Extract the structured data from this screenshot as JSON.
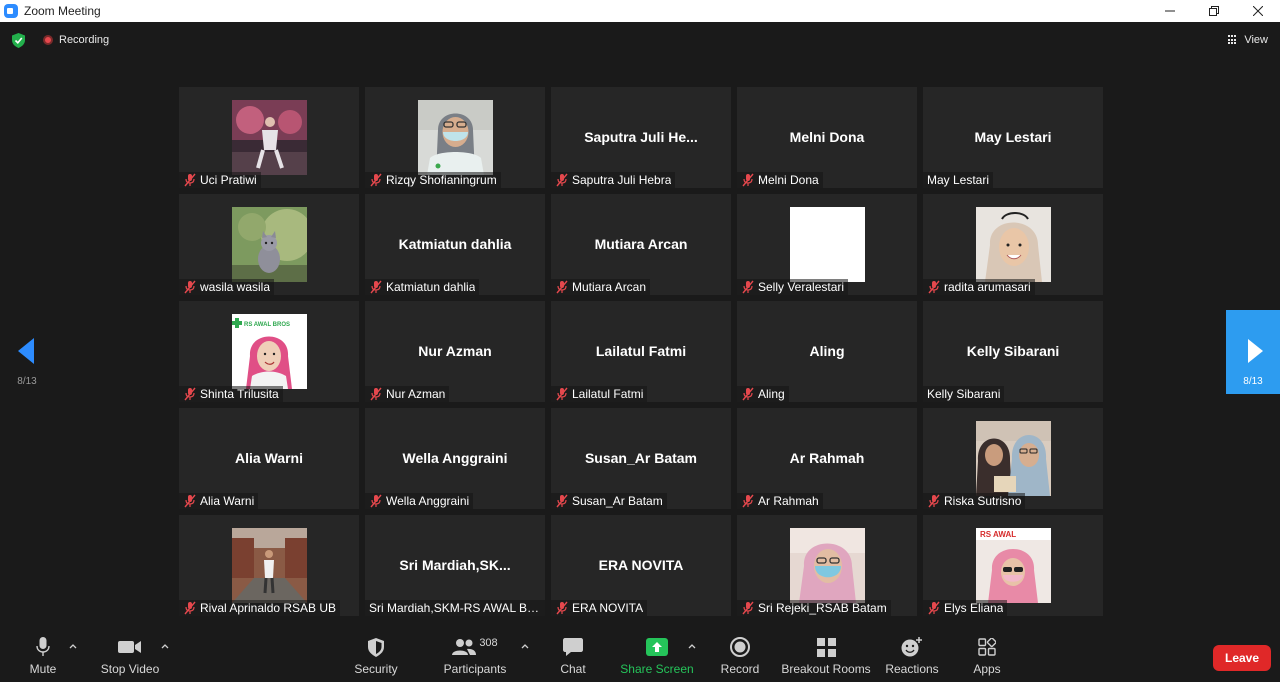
{
  "window": {
    "title": "Zoom Meeting"
  },
  "topbar": {
    "recording_label": "Recording",
    "view_label": "View"
  },
  "pagination": {
    "left_page": "8/13",
    "right_page": "8/13"
  },
  "participants": [
    {
      "name": "Uci Pratiwi",
      "display": "",
      "muted": true,
      "photo": "stage"
    },
    {
      "name": "Rizqy Shofianingrum",
      "display": "",
      "muted": true,
      "photo": "nurse-mask"
    },
    {
      "name": "Saputra Juli Hebra",
      "display": "Saputra  Juli  He...",
      "muted": true,
      "photo": ""
    },
    {
      "name": "Melni Dona",
      "display": "Melni Dona",
      "muted": true,
      "photo": ""
    },
    {
      "name": "May Lestari",
      "display": "May Lestari",
      "muted": false,
      "photo": ""
    },
    {
      "name": "wasila wasila",
      "display": "",
      "muted": true,
      "photo": "cat"
    },
    {
      "name": "Katmiatun dahlia",
      "display": "Katmiatun dahlia",
      "muted": true,
      "photo": ""
    },
    {
      "name": "Mutiara Arcan",
      "display": "Mutiara Arcan",
      "muted": true,
      "photo": ""
    },
    {
      "name": "Selly Veralestari",
      "display": "",
      "muted": true,
      "photo": "white"
    },
    {
      "name": "radita arumasari",
      "display": "",
      "muted": true,
      "photo": "hijab-smile"
    },
    {
      "name": "Shinta Trilusita",
      "display": "",
      "muted": true,
      "photo": "pink-hijab"
    },
    {
      "name": "Nur Azman",
      "display": "Nur Azman",
      "muted": true,
      "photo": ""
    },
    {
      "name": "Lailatul Fatmi",
      "display": "Lailatul Fatmi",
      "muted": true,
      "photo": ""
    },
    {
      "name": "Aling",
      "display": "Aling",
      "muted": true,
      "photo": ""
    },
    {
      "name": "Kelly Sibarani",
      "display": "Kelly Sibarani",
      "muted": false,
      "photo": ""
    },
    {
      "name": "Alia Warni",
      "display": "Alia Warni",
      "muted": true,
      "photo": ""
    },
    {
      "name": "Wella Anggraini",
      "display": "Wella Anggraini",
      "muted": true,
      "photo": ""
    },
    {
      "name": "Susan_Ar Batam",
      "display": "Susan_Ar Batam",
      "muted": true,
      "photo": ""
    },
    {
      "name": "Ar Rahmah",
      "display": "Ar Rahmah",
      "muted": true,
      "photo": ""
    },
    {
      "name": "Riska Sutrisno",
      "display": "",
      "muted": true,
      "photo": "two-women"
    },
    {
      "name": "Rival Aprinaldo RSAB UB",
      "display": "",
      "muted": true,
      "photo": "street"
    },
    {
      "name": "Sri Mardiah,SKM-RS AWAL BR...",
      "display": "Sri  Mardiah,SK...",
      "muted": false,
      "photo": ""
    },
    {
      "name": "ERA NOVITA",
      "display": "ERA NOVITA",
      "muted": true,
      "photo": ""
    },
    {
      "name": "Sri Rejeki_RSAB Batam",
      "display": "",
      "muted": true,
      "photo": "mask-pink"
    },
    {
      "name": "Elys Eliana",
      "display": "",
      "muted": true,
      "photo": "rs-awal"
    }
  ],
  "photo_text": {
    "rs_awal": "RS AWAL",
    "rs_awal_bros": "RS AWAL BROS"
  },
  "toolbar": {
    "mute": "Mute",
    "stop_video": "Stop Video",
    "security": "Security",
    "participants": "Participants",
    "participants_count": "308",
    "chat": "Chat",
    "share_screen": "Share Screen",
    "record": "Record",
    "breakout_rooms": "Breakout Rooms",
    "reactions": "Reactions",
    "apps": "Apps",
    "leave": "Leave"
  },
  "colors": {
    "accent": "#2d8cff",
    "share_green": "#25c45a",
    "leave_red": "#e02828",
    "muted_red": "#e5484d"
  }
}
